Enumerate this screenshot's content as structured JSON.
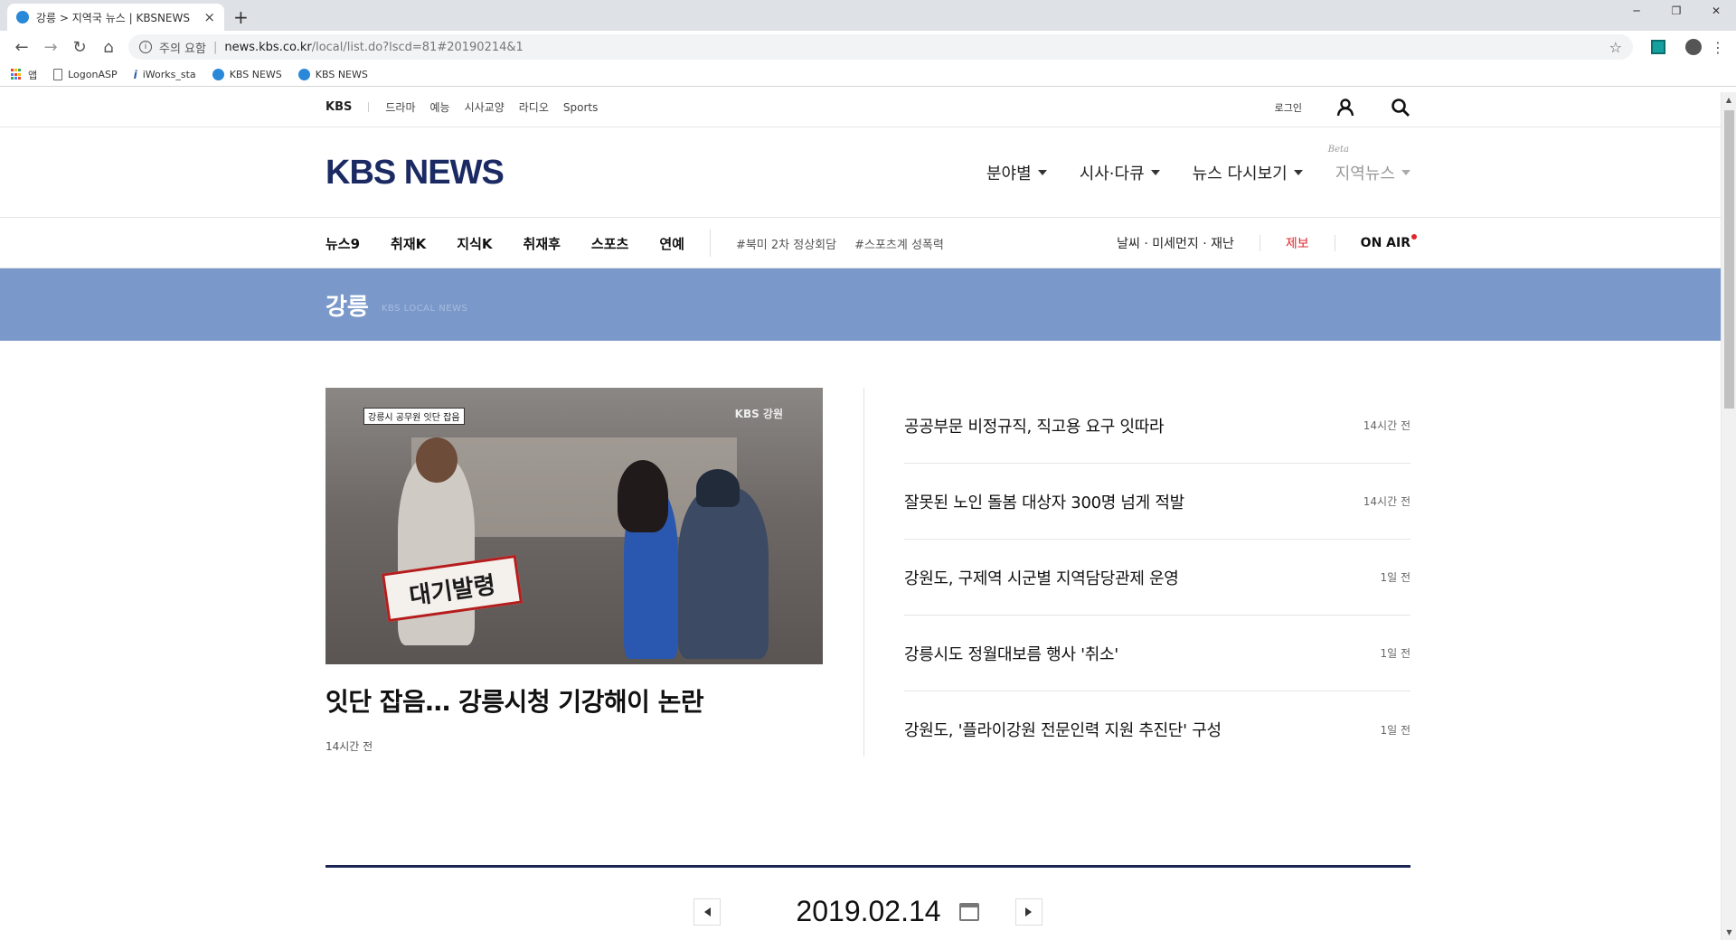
{
  "browser": {
    "tab_title": "강릉 > 지역국 뉴스 | KBSNEWS",
    "url_warning": "주의 요함",
    "url_host": "news.kbs.co.kr",
    "url_path": "/local/list.do?lscd=81#20190214&1",
    "bookmarks": [
      {
        "label": "앱",
        "icon": "apps-icon"
      },
      {
        "label": "LogonASP",
        "icon": "page-icon"
      },
      {
        "label": "iWorks_sta",
        "icon": "iworks-icon"
      },
      {
        "label": "KBS NEWS",
        "icon": "kbs-icon"
      },
      {
        "label": "KBS NEWS",
        "icon": "kbs-icon"
      }
    ]
  },
  "util_nav": {
    "brand": "KBS",
    "items": [
      "드라마",
      "예능",
      "시사교양",
      "라디오",
      "Sports"
    ],
    "login": "로그인"
  },
  "header": {
    "logo": "KBS NEWS",
    "menu": [
      {
        "label": "분야별"
      },
      {
        "label": "시사·다큐"
      },
      {
        "label": "뉴스 다시보기"
      },
      {
        "label": "지역뉴스",
        "badge": "Beta"
      }
    ]
  },
  "sub_nav": {
    "programs": [
      "뉴스9",
      "취재K",
      "지식K",
      "취재후",
      "스포츠",
      "연예"
    ],
    "tags": [
      "#북미 2차 정상회담",
      "#스포츠계 성폭력"
    ],
    "weather": "날씨 · 미세먼지 · 재난",
    "report": "제보",
    "onair": "ON AIR"
  },
  "banner": {
    "region": "강릉",
    "subtitle": "KBS LOCAL NEWS"
  },
  "featured": {
    "image_caption": "강릉시 공무원 잇단 잡음",
    "image_watermark": "KBS 강원",
    "image_stamp": "대기발령",
    "title": "잇단 잡음… 강릉시청 기강해이 논란",
    "time": "14시간 전"
  },
  "articles": [
    {
      "title": "공공부문 비정규직, 직고용 요구 잇따라",
      "time": "14시간 전"
    },
    {
      "title": "잘못된 노인 돌봄 대상자 300명 넘게 적발",
      "time": "14시간 전"
    },
    {
      "title": "강원도, 구제역 시군별 지역담당관제 운영",
      "time": "1일 전"
    },
    {
      "title": "강릉시도 정월대보름 행사 '취소'",
      "time": "1일 전"
    },
    {
      "title": "강원도, '플라이강원 전문인력 지원 추진단' 구성",
      "time": "1일 전"
    }
  ],
  "date_nav": {
    "date": "2019.02.14"
  },
  "colors": {
    "banner": "#7a98c9",
    "logo": "#1b2a63",
    "accent_red": "#e0262b",
    "rule": "#1b2452"
  }
}
